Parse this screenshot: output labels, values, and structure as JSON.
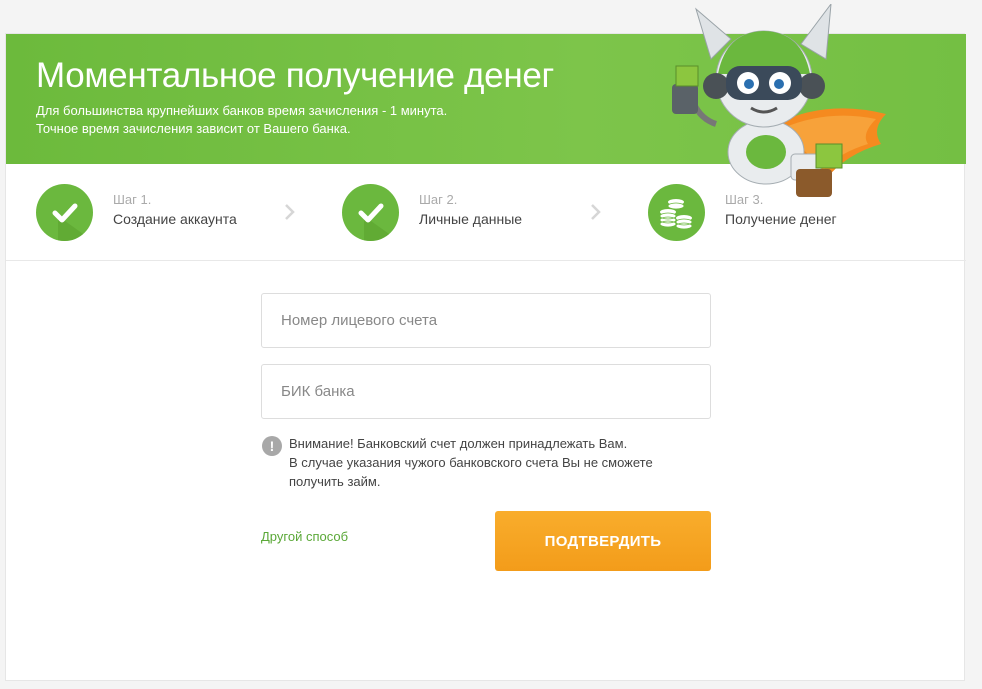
{
  "banner": {
    "title": "Моментальное получение денег",
    "subtitle_line1": "Для большинства крупнейших банков время зачисления - 1 минута.",
    "subtitle_line2": "Точное время зачисления зависит от Вашего банка."
  },
  "steps": [
    {
      "number": "Шаг 1.",
      "name": "Создание аккаунта",
      "status": "done",
      "icon": "check-icon"
    },
    {
      "number": "Шаг 2.",
      "name": "Личные данные",
      "status": "done",
      "icon": "check-icon"
    },
    {
      "number": "Шаг 3.",
      "name": "Получение денег",
      "status": "current",
      "icon": "coins-icon"
    }
  ],
  "form": {
    "account_placeholder": "Номер лицевого счета",
    "account_value": "",
    "bik_placeholder": "БИК банка",
    "bik_value": ""
  },
  "warning": {
    "line1": "Внимание! Банковский счет должен принадлежать Вам.",
    "line2": "В случае указания чужого банковского счета Вы не сможете",
    "line3": "получить займ."
  },
  "actions": {
    "alt_link": "Другой способ",
    "confirm_label": "ПОДТВЕРДИТЬ"
  },
  "colors": {
    "brand_green": "#6bb83e",
    "accent_orange": "#f5a623"
  }
}
